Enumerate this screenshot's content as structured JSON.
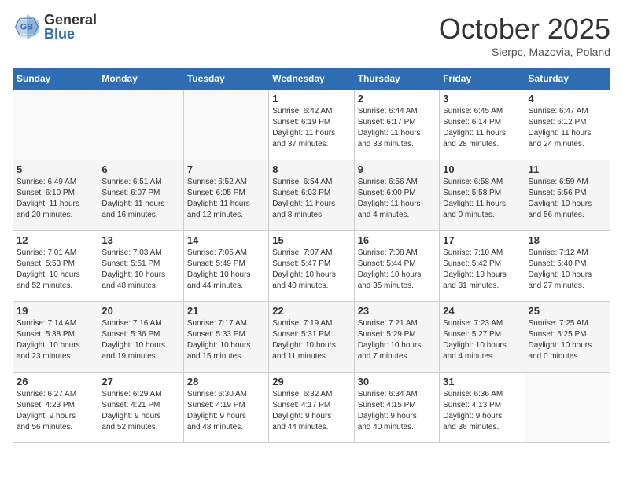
{
  "header": {
    "logo_general": "General",
    "logo_blue": "Blue",
    "month": "October 2025",
    "location": "Sierpc, Mazovia, Poland"
  },
  "days_of_week": [
    "Sunday",
    "Monday",
    "Tuesday",
    "Wednesday",
    "Thursday",
    "Friday",
    "Saturday"
  ],
  "weeks": [
    [
      {
        "day": "",
        "info": ""
      },
      {
        "day": "",
        "info": ""
      },
      {
        "day": "",
        "info": ""
      },
      {
        "day": "1",
        "info": "Sunrise: 6:42 AM\nSunset: 6:19 PM\nDaylight: 11 hours\nand 37 minutes."
      },
      {
        "day": "2",
        "info": "Sunrise: 6:44 AM\nSunset: 6:17 PM\nDaylight: 11 hours\nand 33 minutes."
      },
      {
        "day": "3",
        "info": "Sunrise: 6:45 AM\nSunset: 6:14 PM\nDaylight: 11 hours\nand 28 minutes."
      },
      {
        "day": "4",
        "info": "Sunrise: 6:47 AM\nSunset: 6:12 PM\nDaylight: 11 hours\nand 24 minutes."
      }
    ],
    [
      {
        "day": "5",
        "info": "Sunrise: 6:49 AM\nSunset: 6:10 PM\nDaylight: 11 hours\nand 20 minutes."
      },
      {
        "day": "6",
        "info": "Sunrise: 6:51 AM\nSunset: 6:07 PM\nDaylight: 11 hours\nand 16 minutes."
      },
      {
        "day": "7",
        "info": "Sunrise: 6:52 AM\nSunset: 6:05 PM\nDaylight: 11 hours\nand 12 minutes."
      },
      {
        "day": "8",
        "info": "Sunrise: 6:54 AM\nSunset: 6:03 PM\nDaylight: 11 hours\nand 8 minutes."
      },
      {
        "day": "9",
        "info": "Sunrise: 6:56 AM\nSunset: 6:00 PM\nDaylight: 11 hours\nand 4 minutes."
      },
      {
        "day": "10",
        "info": "Sunrise: 6:58 AM\nSunset: 5:58 PM\nDaylight: 11 hours\nand 0 minutes."
      },
      {
        "day": "11",
        "info": "Sunrise: 6:59 AM\nSunset: 5:56 PM\nDaylight: 10 hours\nand 56 minutes."
      }
    ],
    [
      {
        "day": "12",
        "info": "Sunrise: 7:01 AM\nSunset: 5:53 PM\nDaylight: 10 hours\nand 52 minutes."
      },
      {
        "day": "13",
        "info": "Sunrise: 7:03 AM\nSunset: 5:51 PM\nDaylight: 10 hours\nand 48 minutes."
      },
      {
        "day": "14",
        "info": "Sunrise: 7:05 AM\nSunset: 5:49 PM\nDaylight: 10 hours\nand 44 minutes."
      },
      {
        "day": "15",
        "info": "Sunrise: 7:07 AM\nSunset: 5:47 PM\nDaylight: 10 hours\nand 40 minutes."
      },
      {
        "day": "16",
        "info": "Sunrise: 7:08 AM\nSunset: 5:44 PM\nDaylight: 10 hours\nand 35 minutes."
      },
      {
        "day": "17",
        "info": "Sunrise: 7:10 AM\nSunset: 5:42 PM\nDaylight: 10 hours\nand 31 minutes."
      },
      {
        "day": "18",
        "info": "Sunrise: 7:12 AM\nSunset: 5:40 PM\nDaylight: 10 hours\nand 27 minutes."
      }
    ],
    [
      {
        "day": "19",
        "info": "Sunrise: 7:14 AM\nSunset: 5:38 PM\nDaylight: 10 hours\nand 23 minutes."
      },
      {
        "day": "20",
        "info": "Sunrise: 7:16 AM\nSunset: 5:36 PM\nDaylight: 10 hours\nand 19 minutes."
      },
      {
        "day": "21",
        "info": "Sunrise: 7:17 AM\nSunset: 5:33 PM\nDaylight: 10 hours\nand 15 minutes."
      },
      {
        "day": "22",
        "info": "Sunrise: 7:19 AM\nSunset: 5:31 PM\nDaylight: 10 hours\nand 11 minutes."
      },
      {
        "day": "23",
        "info": "Sunrise: 7:21 AM\nSunset: 5:29 PM\nDaylight: 10 hours\nand 7 minutes."
      },
      {
        "day": "24",
        "info": "Sunrise: 7:23 AM\nSunset: 5:27 PM\nDaylight: 10 hours\nand 4 minutes."
      },
      {
        "day": "25",
        "info": "Sunrise: 7:25 AM\nSunset: 5:25 PM\nDaylight: 10 hours\nand 0 minutes."
      }
    ],
    [
      {
        "day": "26",
        "info": "Sunrise: 6:27 AM\nSunset: 4:23 PM\nDaylight: 9 hours\nand 56 minutes."
      },
      {
        "day": "27",
        "info": "Sunrise: 6:29 AM\nSunset: 4:21 PM\nDaylight: 9 hours\nand 52 minutes."
      },
      {
        "day": "28",
        "info": "Sunrise: 6:30 AM\nSunset: 4:19 PM\nDaylight: 9 hours\nand 48 minutes."
      },
      {
        "day": "29",
        "info": "Sunrise: 6:32 AM\nSunset: 4:17 PM\nDaylight: 9 hours\nand 44 minutes."
      },
      {
        "day": "30",
        "info": "Sunrise: 6:34 AM\nSunset: 4:15 PM\nDaylight: 9 hours\nand 40 minutes."
      },
      {
        "day": "31",
        "info": "Sunrise: 6:36 AM\nSunset: 4:13 PM\nDaylight: 9 hours\nand 36 minutes."
      },
      {
        "day": "",
        "info": ""
      }
    ]
  ]
}
